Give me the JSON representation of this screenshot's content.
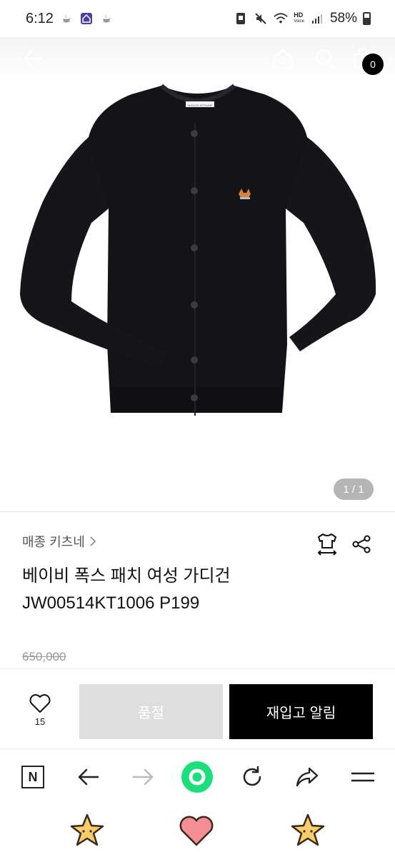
{
  "status_bar": {
    "time": "6:12",
    "battery": "58%",
    "hd_label": "HD",
    "voice_label": "Voice"
  },
  "header": {
    "bag_count": "0"
  },
  "image": {
    "indicator": "1 / 1",
    "label_tag": "MAISON KITSUNÉ"
  },
  "product": {
    "brand": "매종 키츠네",
    "title_line1": "베이비 폭스 패치 여성 가디건",
    "title_line2": "JW00514KT1006 P199",
    "original_price": "650,000"
  },
  "actions": {
    "wish_count": "15",
    "soldout_label": "품절",
    "restock_label": "재입고 알림"
  },
  "browser": {
    "n_label": "N"
  }
}
